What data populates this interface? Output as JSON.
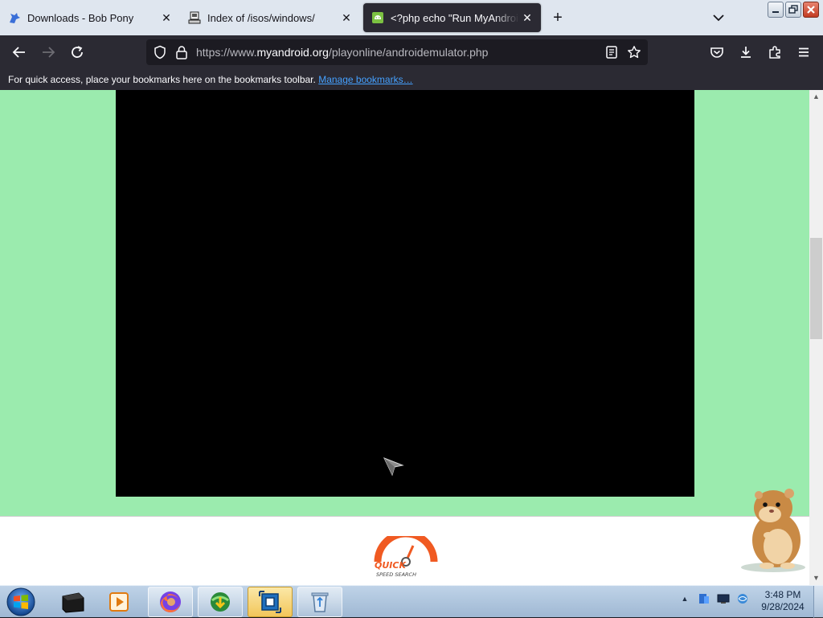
{
  "browser": {
    "tabs": [
      {
        "title": "Downloads - Bob Pony",
        "icon": "bob-pony-favicon",
        "active": false
      },
      {
        "title": "Index of /isos/windows/",
        "icon": "server-favicon",
        "active": false
      },
      {
        "title": "<?php echo \"Run MyAndroid\"; ?>",
        "icon": "android-favicon",
        "active": true
      }
    ],
    "new_tab_label": "+",
    "url": {
      "prefix": "https://www.",
      "domain": "myandroid.org",
      "path": "/playonline/androidemulator.php"
    },
    "bookmarks_bar": {
      "message": "For quick access, place your bookmarks here on the bookmarks toolbar.",
      "link": "Manage bookmarks…"
    }
  },
  "page": {
    "background_color": "#9bebae",
    "emulator_color": "#000000",
    "ad_logo": {
      "line1": "QUICK",
      "line2": "SPEED SEARCH"
    }
  },
  "taskbar": {
    "items": [
      "terminal-icon",
      "media-player-icon",
      "firefox-icon",
      "download-manager-icon",
      "virtualbox-icon",
      "recycle-tool-icon"
    ],
    "tray": [
      "show-hidden-icons",
      "network-monitor-icon",
      "display-icon",
      "network-icon"
    ],
    "clock": {
      "time": "3:48 PM",
      "date": "9/28/2024"
    }
  },
  "colors": {
    "tabstrip": "#dfe6ef",
    "toolbar": "#2b2a33",
    "urlbar": "#1c1b22",
    "link": "#45a1ff"
  }
}
